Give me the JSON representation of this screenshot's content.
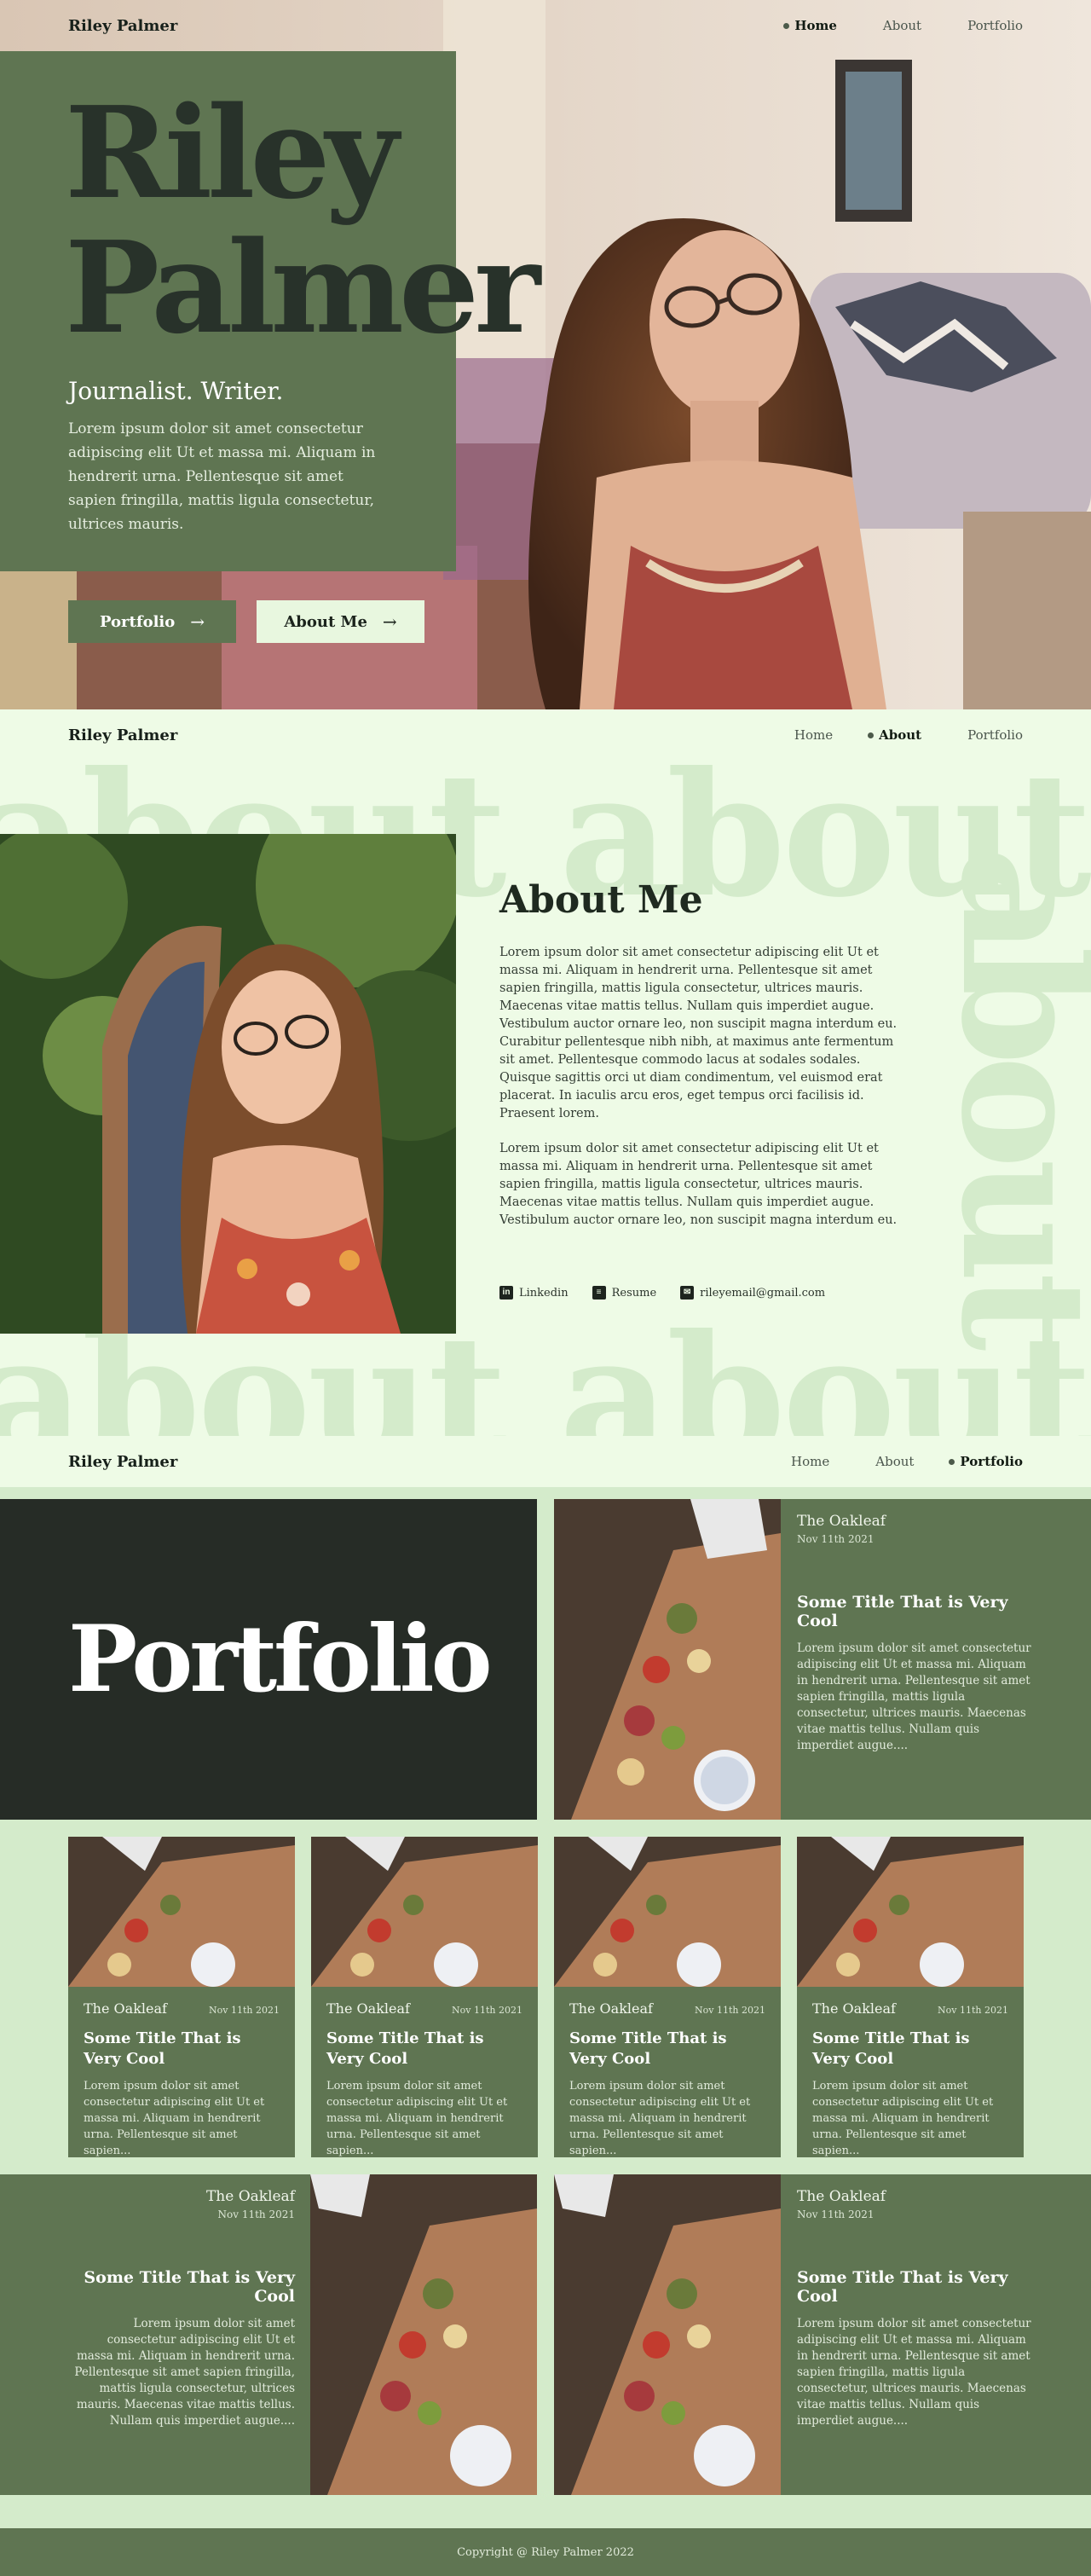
{
  "nav": {
    "brand": "Riley Palmer",
    "links": [
      {
        "label": "Home"
      },
      {
        "label": "About"
      },
      {
        "label": "Portfolio"
      }
    ]
  },
  "hero": {
    "name_line1": "Riley",
    "name_line2": "Palmer",
    "tagline": "Journalist. Writer.",
    "description": "Lorem ipsum dolor sit amet consectetur adipiscing elit Ut et massa mi. Aliquam in hendrerit urna. Pellentesque sit amet sapien fringilla, mattis ligula consectetur, ultrices mauris.",
    "buttons": {
      "portfolio": "Portfolio",
      "about": "About Me"
    }
  },
  "about": {
    "bg_word": "about about abo",
    "bg_vertical": "about",
    "title": "About Me",
    "paragraph1": "Lorem ipsum dolor sit amet consectetur adipiscing elit Ut et massa mi. Aliquam in hendrerit urna. Pellentesque sit amet sapien fringilla, mattis ligula consectetur, ultrices mauris. Maecenas vitae mattis tellus. Nullam quis imperdiet augue. Vestibulum auctor ornare leo, non suscipit magna interdum eu. Curabitur pellentesque nibh nibh, at maximus ante fermentum sit amet. Pellentesque commodo lacus at sodales sodales. Quisque sagittis orci ut diam condimentum, vel euismod erat placerat. In iaculis arcu eros, eget tempus orci facilisis id. Praesent lorem.",
    "paragraph2": "Lorem ipsum dolor sit amet consectetur adipiscing elit Ut et massa mi. Aliquam in hendrerit urna. Pellentesque sit amet sapien fringilla, mattis ligula consectetur, ultrices mauris. Maecenas vitae mattis tellus. Nullam quis imperdiet augue. Vestibulum auctor ornare leo, non suscipit magna interdum eu.",
    "links": {
      "linkedin": "Linkedin",
      "resume": "Resume",
      "email": "rileyemail@gmail.com"
    }
  },
  "portfolio": {
    "title": "Portfolio",
    "featured": {
      "publication": "The Oakleaf",
      "date": "Nov 11th 2021",
      "title": "Some Title That is Very Cool",
      "description": "Lorem ipsum dolor sit amet consectetur adipiscing elit Ut et massa mi. Aliquam in hendrerit urna. Pellentesque sit amet sapien fringilla, mattis ligula consectetur, ultrices mauris. Maecenas vitae mattis tellus. Nullam quis imperdiet augue...."
    },
    "cards": [
      {
        "publication": "The Oakleaf",
        "date": "Nov 11th 2021",
        "title": "Some Title That is Very Cool",
        "description": "Lorem ipsum dolor sit amet consectetur adipiscing elit Ut et massa mi. Aliquam in hendrerit urna. Pellentesque sit amet sapien..."
      },
      {
        "publication": "The Oakleaf",
        "date": "Nov 11th 2021",
        "title": "Some Title That is Very Cool",
        "description": "Lorem ipsum dolor sit amet consectetur adipiscing elit Ut et massa mi. Aliquam in hendrerit urna. Pellentesque sit amet sapien..."
      },
      {
        "publication": "The Oakleaf",
        "date": "Nov 11th 2021",
        "title": "Some Title That is Very Cool",
        "description": "Lorem ipsum dolor sit amet consectetur adipiscing elit Ut et massa mi. Aliquam in hendrerit urna. Pellentesque sit amet sapien..."
      },
      {
        "publication": "The Oakleaf",
        "date": "Nov 11th 2021",
        "title": "Some Title That is Very Cool",
        "description": "Lorem ipsum dolor sit amet consectetur adipiscing elit Ut et massa mi. Aliquam in hendrerit urna. Pellentesque sit amet sapien..."
      }
    ],
    "bottom_left": {
      "publication": "The Oakleaf",
      "date": "Nov 11th 2021",
      "title": "Some Title That is Very Cool",
      "description": "Lorem ipsum dolor sit amet consectetur adipiscing elit Ut et massa mi. Aliquam in hendrerit urna. Pellentesque sit amet sapien fringilla, mattis ligula consectetur, ultrices mauris. Maecenas vitae mattis tellus. Nullam quis imperdiet augue...."
    },
    "bottom_right": {
      "publication": "The Oakleaf",
      "date": "Nov 11th 2021",
      "title": "Some Title That is Very Cool",
      "description": "Lorem ipsum dolor sit amet consectetur adipiscing elit Ut et massa mi. Aliquam in hendrerit urna. Pellentesque sit amet sapien fringilla, mattis ligula consectetur, ultrices mauris. Maecenas vitae mattis tellus. Nullam quis imperdiet augue...."
    }
  },
  "footer": {
    "text": "Copyright @ Riley Palmer 2022"
  },
  "colors": {
    "accent_green": "#5f7552",
    "dark_panel": "#262c26",
    "light_mint": "#eefbe6",
    "mid_mint": "#d4ebcb"
  },
  "icons": {
    "portfolio_arrow": "arrow-right-icon",
    "about_arrow": "arrow-right-icon",
    "linkedin": "linkedin-icon",
    "resume": "document-icon",
    "email": "mail-icon"
  }
}
